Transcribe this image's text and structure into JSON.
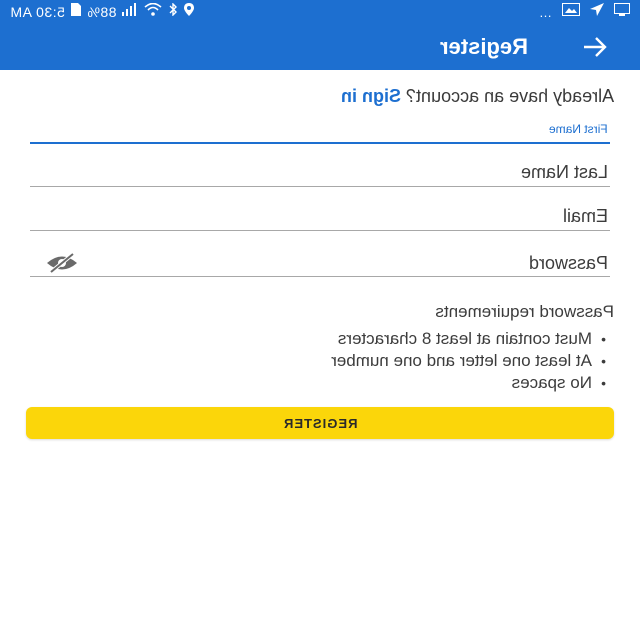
{
  "status_bar": {
    "time": "5:30 AM",
    "battery": "88%",
    "right_dots": "…"
  },
  "app_bar": {
    "title": "Register"
  },
  "signin": {
    "prompt": "Already have an account?",
    "link": "Sign in"
  },
  "form": {
    "first_name_label": "First Name",
    "last_name_label": "Last Name",
    "email_label": "Email",
    "password_label": "Password"
  },
  "requirements": {
    "title": "Password requirements",
    "items": [
      "Must contain at least 8 characters",
      "At least one letter and one number",
      "No spaces"
    ]
  },
  "register_button": {
    "label": "REGISTER"
  },
  "colors": {
    "primary": "#1d6fd0",
    "button": "#fbd60a"
  }
}
